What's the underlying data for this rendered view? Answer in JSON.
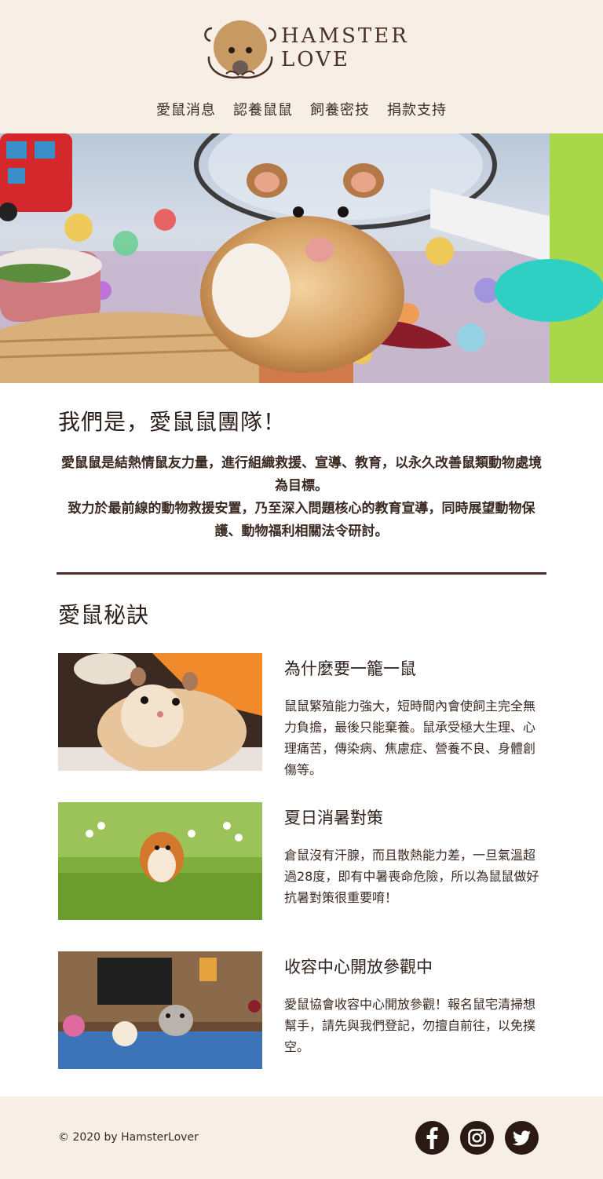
{
  "brand": {
    "line1": "HAMSTER",
    "line2": "LOVE"
  },
  "nav": [
    {
      "label": "愛鼠消息"
    },
    {
      "label": "認養鼠鼠"
    },
    {
      "label": "飼養密技"
    },
    {
      "label": "捐款支持"
    }
  ],
  "about": {
    "title": "我們是，愛鼠鼠團隊！",
    "p1": "愛鼠鼠是結熱情鼠友力量，進行組織救援、宣導、教育，以永久改善鼠類動物處境為目標。",
    "p2": "致力於最前線的動物救援安置，乃至深入問題核心的教育宣導，同時展望動物保護、動物福利相關法令研討。"
  },
  "tips": {
    "title": "愛鼠秘訣",
    "items": [
      {
        "title": "為什麼要一籠一鼠",
        "text": "鼠鼠繁殖能力強大，短時間內會使飼主完全無力負擔，最後只能棄養。鼠承受極大生理、心理痛苦，傳染病、焦慮症、營養不良、身體創傷等。",
        "image_icon": "hamster-photo"
      },
      {
        "title": "夏日消暑對策",
        "text": "倉鼠沒有汗腺，而且散熱能力差，一旦氣溫超過28度，即有中暑喪命危險，所以為鼠鼠做好抗暑對策很重要唷！",
        "image_icon": "hamster-grass-photo"
      },
      {
        "title": "收容中心開放參觀中",
        "text": "愛鼠協會收容中心開放參觀！報名鼠宅清掃想幫手，請先與我們登記，勿擅自前往，以免撲空。",
        "image_icon": "hamster-cafe-photo"
      }
    ]
  },
  "footer": {
    "copyright": "© 2020 by HamsterLover"
  },
  "social": [
    {
      "icon": "facebook-icon"
    },
    {
      "icon": "instagram-icon"
    },
    {
      "icon": "twitter-icon"
    }
  ],
  "colors": {
    "cream": "#f7efe6",
    "brown": "#4a3025",
    "text": "#3b2a22"
  }
}
